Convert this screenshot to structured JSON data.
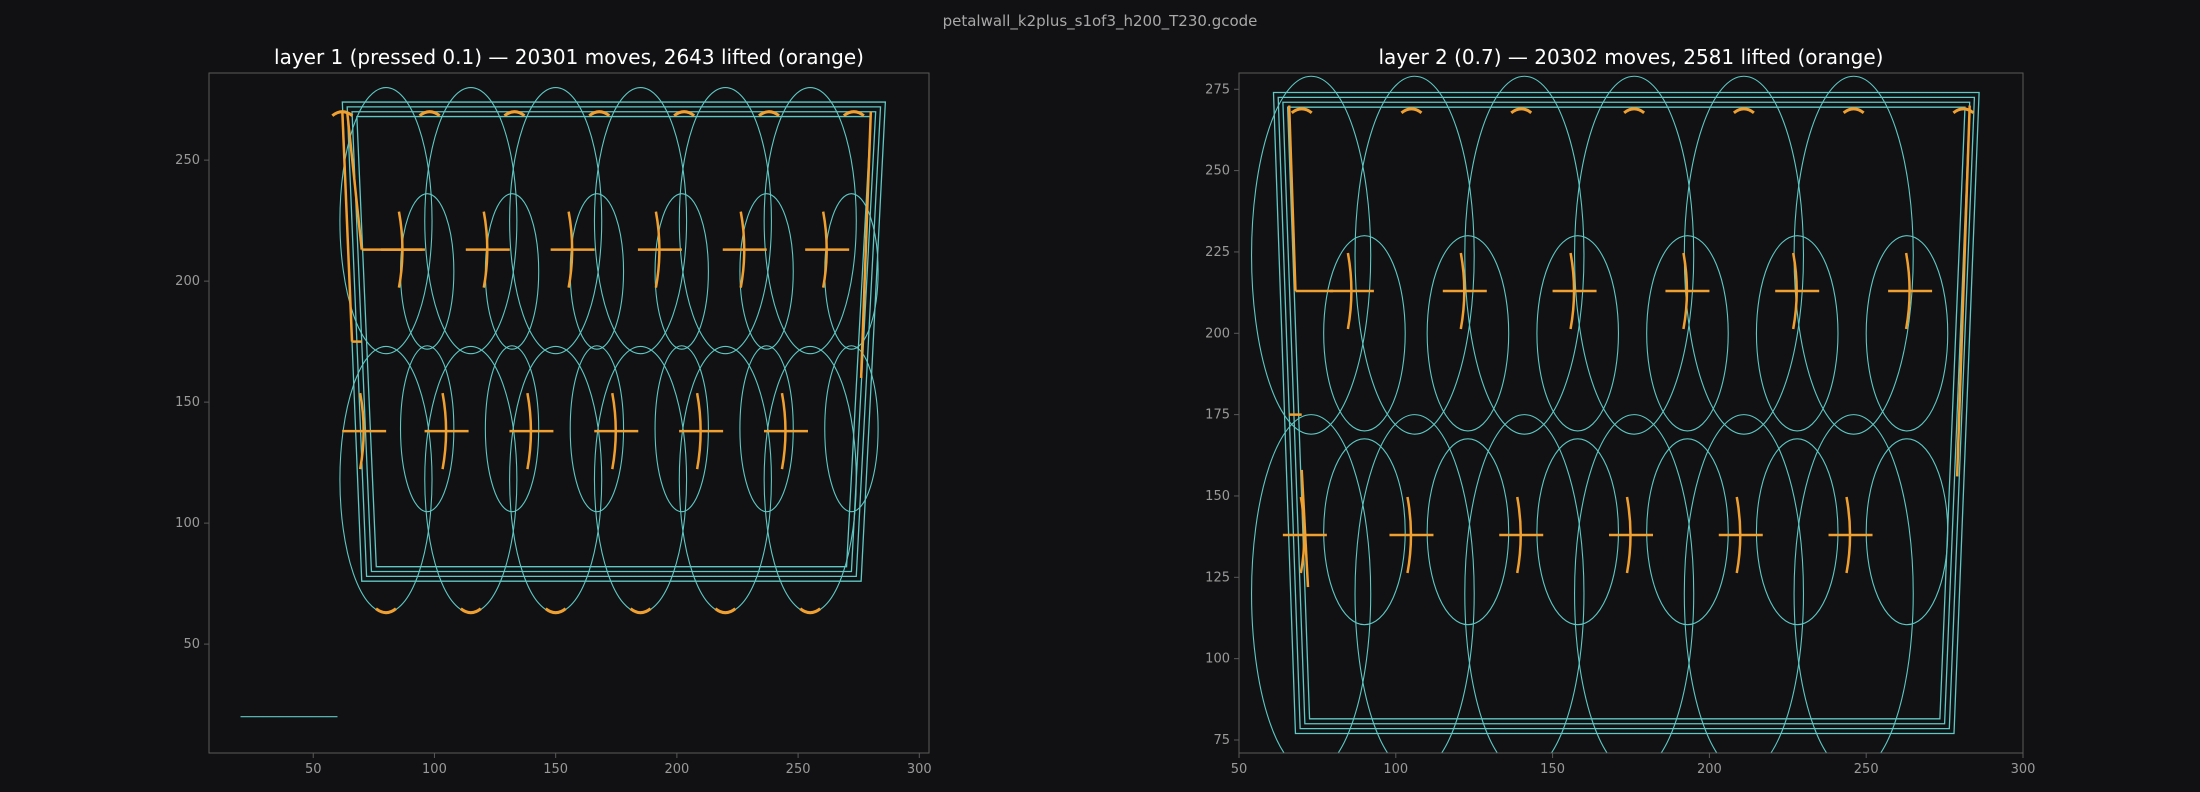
{
  "figure_title": "petalwall_k2plus_s1of3_h200_T230.gcode",
  "colors": {
    "background": "#111113",
    "extrude": "#5ec8c4",
    "lifted": "#f0a030",
    "axes": "#5a5a5a",
    "tick": "#9a9a9a",
    "title": "#ffffff"
  },
  "chart_data": [
    {
      "type": "scatter",
      "title": "layer 1 (pressed 0.1) — 20301 moves, 2643 lifted (orange)",
      "xlim": [
        7,
        304
      ],
      "ylim": [
        5,
        286
      ],
      "xticks": [
        50,
        100,
        150,
        200,
        250,
        300
      ],
      "yticks": [
        50,
        100,
        150,
        200,
        250
      ],
      "grid": false,
      "outline": {
        "top_y": 274,
        "bottom_y": 76,
        "top_x": [
          62,
          286
        ],
        "bottom_x": [
          70,
          276
        ],
        "rings": 4,
        "ring_step": 2
      },
      "petal_rows": [
        {
          "y": 225,
          "x_centers": [
            80,
            115,
            150,
            185,
            220,
            255
          ],
          "inner_y": 204,
          "inner_half_height": 45,
          "inner_half_width": 11,
          "outer_half_width": 19
        },
        {
          "y": 118,
          "x_centers": [
            80,
            115,
            150,
            185,
            220,
            255
          ],
          "inner_y": 139,
          "inner_half_height": 48,
          "inner_half_width": 11,
          "outer_half_width": 19
        }
      ],
      "crosses": [
        {
          "x": 87,
          "y": 213
        },
        {
          "x": 122,
          "y": 213
        },
        {
          "x": 157,
          "y": 213
        },
        {
          "x": 193,
          "y": 213
        },
        {
          "x": 228,
          "y": 213
        },
        {
          "x": 262,
          "y": 213
        },
        {
          "x": 71,
          "y": 138
        },
        {
          "x": 105,
          "y": 138
        },
        {
          "x": 140,
          "y": 138
        },
        {
          "x": 175,
          "y": 138
        },
        {
          "x": 210,
          "y": 138
        },
        {
          "x": 245,
          "y": 138
        }
      ],
      "bottom_arcs_x": [
        80,
        115,
        150,
        185,
        220,
        255
      ],
      "top_arcs_x": [
        62,
        98,
        133,
        168,
        203,
        238,
        273
      ],
      "lifted_lines": [
        [
          [
            62,
            270
          ],
          [
            66,
            175
          ]
        ],
        [
          [
            66,
            175
          ],
          [
            70,
            175
          ]
        ],
        [
          [
            64,
            270
          ],
          [
            70,
            213
          ]
        ],
        [
          [
            70,
            213
          ],
          [
            95,
            213
          ]
        ],
        [
          [
            280,
            270
          ],
          [
            276,
            160
          ]
        ]
      ],
      "extra_lines": [
        [
          [
            20,
            20
          ],
          [
            60,
            20
          ]
        ]
      ]
    },
    {
      "type": "scatter",
      "title": "layer 2 (0.7) — 20302 moves, 2581 lifted (orange)",
      "xlim": [
        50,
        300
      ],
      "ylim": [
        71,
        280
      ],
      "xticks": [
        50,
        100,
        150,
        200,
        250,
        300
      ],
      "yticks": [
        75,
        100,
        125,
        150,
        175,
        200,
        225,
        250,
        275
      ],
      "grid": false,
      "outline": {
        "top_y": 274,
        "bottom_y": 77,
        "top_x": [
          61,
          286
        ],
        "bottom_x": [
          68,
          278
        ],
        "rings": 4,
        "ring_step": 1.5
      },
      "petal_rows": [
        {
          "y": 224,
          "x_centers": [
            73,
            106,
            141,
            176,
            211,
            246
          ],
          "inner_y": 200,
          "inner_half_height": 42,
          "inner_half_width": 13,
          "outer_half_width": 19
        },
        {
          "y": 120,
          "x_centers": [
            73,
            106,
            141,
            176,
            211,
            246
          ],
          "inner_y": 139,
          "inner_half_height": 40,
          "inner_half_width": 13,
          "outer_half_width": 19
        }
      ],
      "crosses": [
        {
          "x": 86,
          "y": 213
        },
        {
          "x": 122,
          "y": 213
        },
        {
          "x": 157,
          "y": 213
        },
        {
          "x": 193,
          "y": 213
        },
        {
          "x": 228,
          "y": 213
        },
        {
          "x": 264,
          "y": 213
        },
        {
          "x": 71,
          "y": 138
        },
        {
          "x": 105,
          "y": 138
        },
        {
          "x": 140,
          "y": 138
        },
        {
          "x": 175,
          "y": 138
        },
        {
          "x": 210,
          "y": 138
        },
        {
          "x": 245,
          "y": 138
        }
      ],
      "bottom_arcs_x": [
        88,
        123,
        158,
        193,
        228,
        263
      ],
      "top_arcs_x": [
        70,
        105,
        140,
        176,
        211,
        246,
        281
      ],
      "lifted_lines": [
        [
          [
            66,
            270
          ],
          [
            68,
            213
          ]
        ],
        [
          [
            68,
            213
          ],
          [
            80,
            213
          ]
        ],
        [
          [
            66,
            175
          ],
          [
            70,
            175
          ]
        ],
        [
          [
            70,
            158
          ],
          [
            72,
            122
          ]
        ],
        [
          [
            283,
            270
          ],
          [
            279,
            156
          ]
        ]
      ],
      "extra_lines": []
    }
  ]
}
